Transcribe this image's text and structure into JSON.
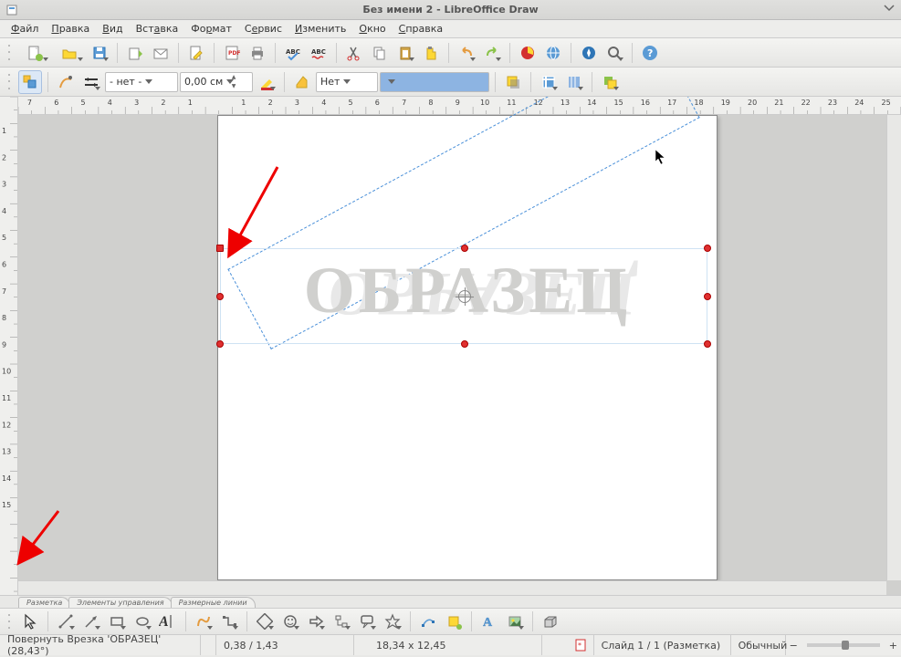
{
  "window": {
    "title": "Без имени 2 - LibreOffice Draw"
  },
  "menus": {
    "file": "Файл",
    "edit": "Правка",
    "view": "Вид",
    "insert": "Вставка",
    "format": "Формат",
    "tools": "Сервис",
    "modify": "Изменить",
    "window": "Окно",
    "help": "Справка"
  },
  "line_toolbar": {
    "style": "- нет -",
    "width": "0,00 см",
    "arrow_style": "Нет"
  },
  "canvas": {
    "text": "ОБРАЗЕЦ",
    "reflection_text": "ОБРАЗЕЦ"
  },
  "tabs": {
    "t1": "Разметка",
    "t2": "Элементы управления",
    "t3": "Размерные линии"
  },
  "status": {
    "action": "Повернуть Врезка 'ОБРАЗЕЦ' (28,43°)",
    "pos": "0,38 / 1,43",
    "size": "18,34 x 12,45",
    "slide": "Слайд 1 / 1 (Разметка)",
    "mode": "Обычный"
  },
  "hruler_numbers": [
    7,
    6,
    5,
    4,
    3,
    2,
    1,
    1,
    2,
    3,
    4,
    5,
    6,
    7,
    8,
    9,
    10,
    11,
    12,
    13,
    14,
    15,
    16,
    17,
    18,
    19,
    20,
    21,
    22,
    23,
    24,
    25
  ],
  "vruler_numbers": [
    1,
    2,
    3,
    4,
    5,
    6,
    7,
    8,
    9,
    10,
    11,
    12,
    13,
    14,
    15
  ]
}
